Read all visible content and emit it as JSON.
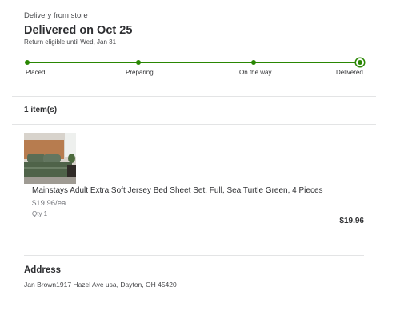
{
  "order": {
    "delivery_type": "Delivery from store",
    "status_title": "Delivered on Oct 25",
    "return_note": "Return eligible until Wed, Jan 31"
  },
  "tracker": {
    "steps": [
      {
        "label": "Placed"
      },
      {
        "label": "Preparing"
      },
      {
        "label": "On the way"
      },
      {
        "label": "Delivered"
      }
    ],
    "current_step": "Delivered",
    "accent_color": "#2a8703"
  },
  "items": {
    "count_label": "1 item(s)",
    "list": [
      {
        "name": "Mainstays Adult Extra Soft Jersey Bed Sheet Set, Full, Sea Turtle Green, 4 Pieces",
        "unit_price": "$19.96/ea",
        "qty": "Qty 1",
        "total": "$19.96",
        "image_icon": "product-image-bed-sheet"
      }
    ]
  },
  "address": {
    "heading": "Address",
    "text": "Jan Brown1917 Hazel Ave usa, Dayton, OH 45420"
  }
}
